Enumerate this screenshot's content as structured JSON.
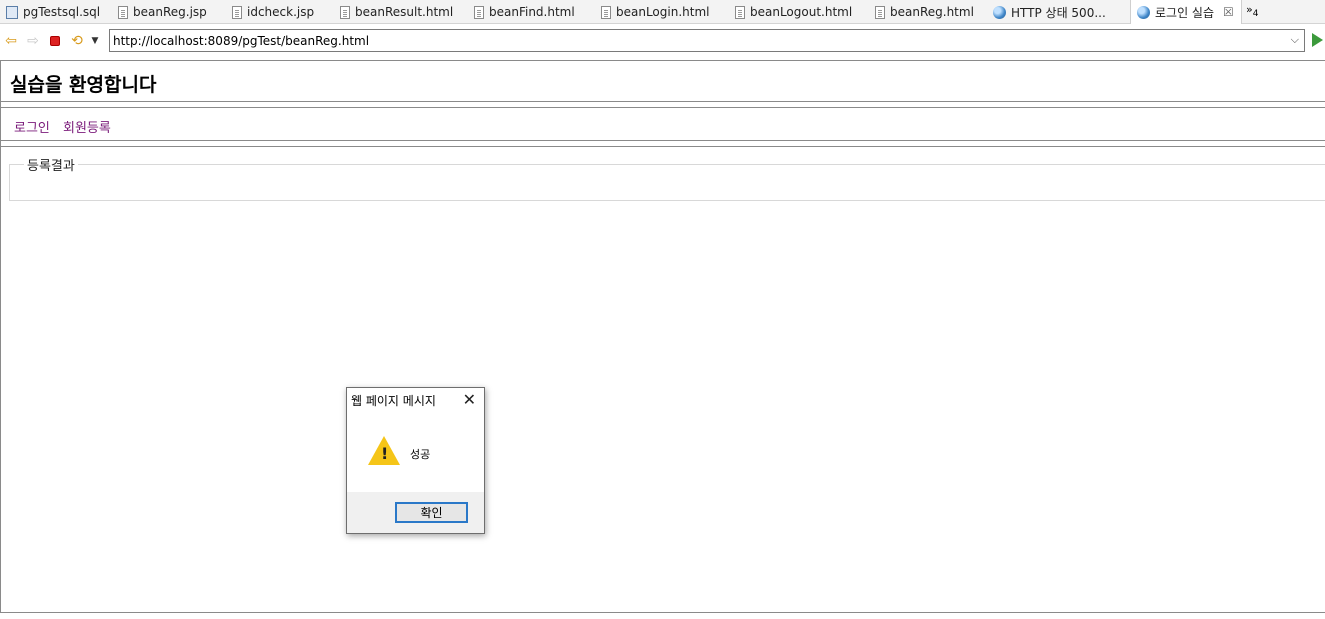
{
  "tabs": [
    {
      "label": "pgTestsql.sql",
      "icon": "database-file-icon",
      "active": false
    },
    {
      "label": "beanReg.jsp",
      "icon": "file-icon",
      "active": false
    },
    {
      "label": "idcheck.jsp",
      "icon": "file-icon",
      "active": false
    },
    {
      "label": "beanResult.html",
      "icon": "file-icon",
      "active": false
    },
    {
      "label": "beanFind.html",
      "icon": "file-icon",
      "active": false
    },
    {
      "label": "beanLogin.html",
      "icon": "file-icon",
      "active": false
    },
    {
      "label": "beanLogout.html",
      "icon": "file-icon",
      "active": false
    },
    {
      "label": "beanReg.html",
      "icon": "file-icon",
      "active": false
    },
    {
      "label": "HTTP 상태 500...",
      "icon": "globe-icon",
      "active": false
    },
    {
      "label": "로그인 실습",
      "icon": "globe-icon",
      "active": true
    }
  ],
  "tabs_overflow": {
    "symbol": "»",
    "count": "4"
  },
  "navbar": {
    "url": "http://localhost:8089/pgTest/beanReg.html"
  },
  "page": {
    "title": "실습을 환영합니다",
    "menu": {
      "login": "로그인",
      "register": "회원등록"
    },
    "fieldset_legend": "등록결과"
  },
  "dialog": {
    "title": "웹 페이지 메시지",
    "message": "성공",
    "ok_label": "확인",
    "icon": "warning-icon"
  },
  "colors": {
    "link": "#7a1a7a",
    "warning": "#f5c518",
    "focus_border": "#2a78c8"
  }
}
